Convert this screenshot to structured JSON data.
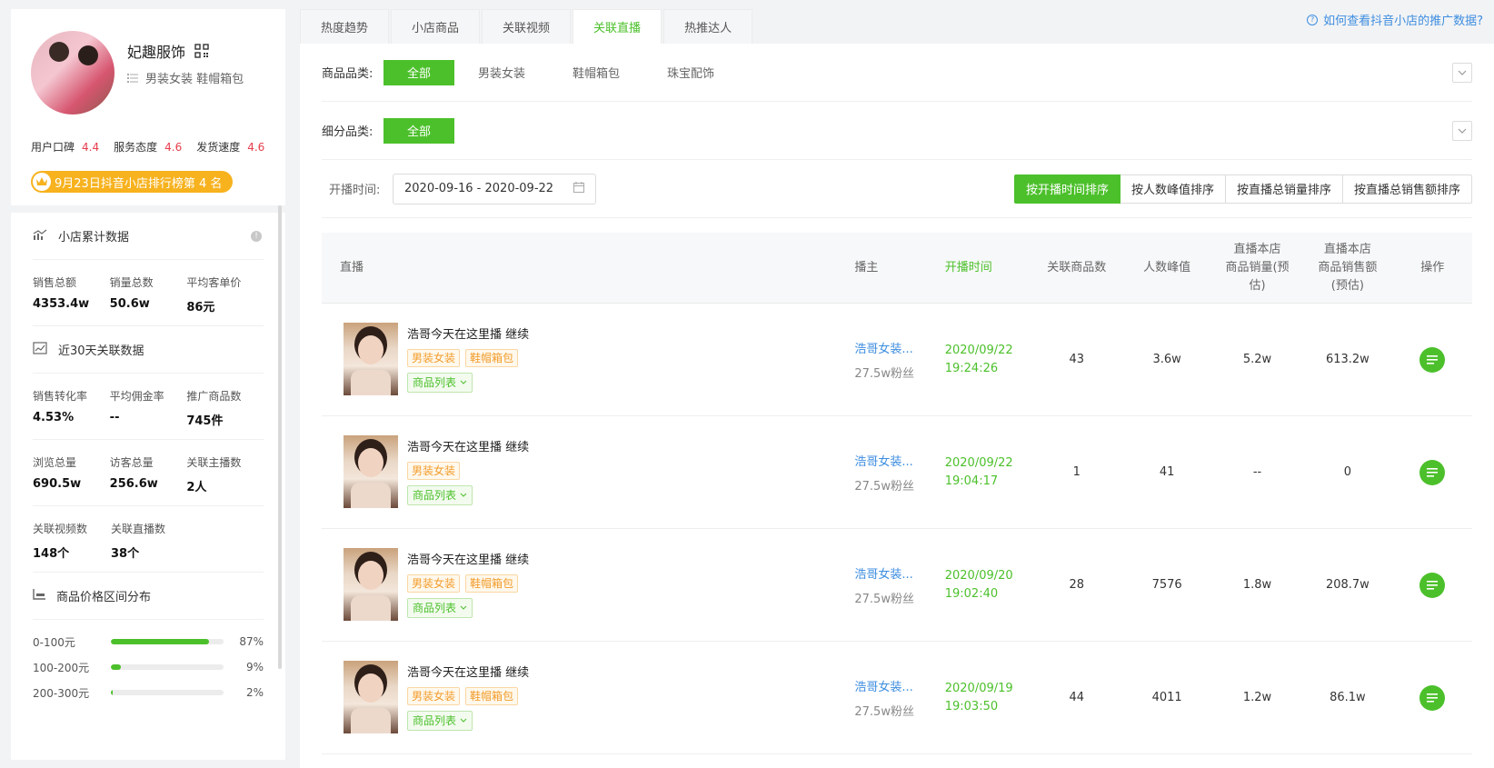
{
  "shop": {
    "name": "妃趣服饰",
    "categories": "男装女装 鞋帽箱包",
    "ratings": [
      {
        "label": "用户口碑",
        "value": "4.4"
      },
      {
        "label": "服务态度",
        "value": "4.6"
      },
      {
        "label": "发货速度",
        "value": "4.6"
      }
    ],
    "rank_badge": "9月23日抖音小店排行榜第 4 名"
  },
  "sections": {
    "cumulative": {
      "title": "小店累计数据",
      "stats": [
        {
          "label": "销售总额",
          "value": "4353.4w"
        },
        {
          "label": "销量总数",
          "value": "50.6w"
        },
        {
          "label": "平均客单价",
          "value": "86元"
        }
      ]
    },
    "recent30": {
      "title": "近30天关联数据",
      "rows": [
        [
          {
            "label": "销售转化率",
            "value": "4.53%"
          },
          {
            "label": "平均佣金率",
            "value": "--"
          },
          {
            "label": "推广商品数",
            "value": "745件"
          }
        ],
        [
          {
            "label": "浏览总量",
            "value": "690.5w"
          },
          {
            "label": "访客总量",
            "value": "256.6w"
          },
          {
            "label": "关联主播数",
            "value": "2人"
          }
        ],
        [
          {
            "label": "关联视频数",
            "value": "148个"
          },
          {
            "label": "关联直播数",
            "value": "38个"
          }
        ]
      ]
    },
    "price_dist": {
      "title": "商品价格区间分布",
      "items": [
        {
          "label": "0-100元",
          "pct": "87%",
          "fraction": 0.87
        },
        {
          "label": "100-200元",
          "pct": "9%",
          "fraction": 0.09
        },
        {
          "label": "200-300元",
          "pct": "2%",
          "fraction": 0.02
        }
      ]
    }
  },
  "tabs": [
    "热度趋势",
    "小店商品",
    "关联视频",
    "关联直播",
    "热推达人"
  ],
  "active_tab": 3,
  "help_link": "如何查看抖音小店的推广数据?",
  "filters": {
    "category_label": "商品品类:",
    "category_options": [
      "全部",
      "男装女装",
      "鞋帽箱包",
      "珠宝配饰"
    ],
    "subcategory_label": "细分品类:",
    "subcategory_options": [
      "全部"
    ]
  },
  "date_filter": {
    "label": "开播时间:",
    "value": "2020-09-16 - 2020-09-22"
  },
  "sort_options": [
    "按开播时间排序",
    "按人数峰值排序",
    "按直播总销量排序",
    "按直播总销售额排序"
  ],
  "table": {
    "headers": {
      "live": "直播",
      "host": "播主",
      "time": "开播时间",
      "count": "关联商品数",
      "peak": "人数峰值",
      "sales_l1": "直播本店",
      "sales_l2": "商品销量(预",
      "sales_l3": "估)",
      "amount_l1": "直播本店",
      "amount_l2": "商品销售额",
      "amount_l3": "(预估)",
      "op": "操作"
    },
    "goods_tag": "商品列表",
    "rows": [
      {
        "title": "浩哥今天在这里播 继续",
        "tags": [
          "男装女装",
          "鞋帽箱包"
        ],
        "host": "浩哥女装...",
        "fans": "27.5w粉丝",
        "date": "2020/09/22",
        "time": "19:24:26",
        "count": "43",
        "peak": "3.6w",
        "sales": "5.2w",
        "amount": "613.2w"
      },
      {
        "title": "浩哥今天在这里播 继续",
        "tags": [
          "男装女装"
        ],
        "host": "浩哥女装...",
        "fans": "27.5w粉丝",
        "date": "2020/09/22",
        "time": "19:04:17",
        "count": "1",
        "peak": "41",
        "sales": "--",
        "amount": "0"
      },
      {
        "title": "浩哥今天在这里播 继续",
        "tags": [
          "男装女装",
          "鞋帽箱包"
        ],
        "host": "浩哥女装...",
        "fans": "27.5w粉丝",
        "date": "2020/09/20",
        "time": "19:02:40",
        "count": "28",
        "peak": "7576",
        "sales": "1.8w",
        "amount": "208.7w"
      },
      {
        "title": "浩哥今天在这里播 继续",
        "tags": [
          "男装女装",
          "鞋帽箱包"
        ],
        "host": "浩哥女装...",
        "fans": "27.5w粉丝",
        "date": "2020/09/19",
        "time": "19:03:50",
        "count": "44",
        "peak": "4011",
        "sales": "1.2w",
        "amount": "86.1w"
      }
    ]
  },
  "colors": {
    "accent": "#4cc02b",
    "link": "#3e8ee0",
    "warn": "#f29c2b",
    "rating": "#e63d4c",
    "badge": "#f7b21e"
  }
}
